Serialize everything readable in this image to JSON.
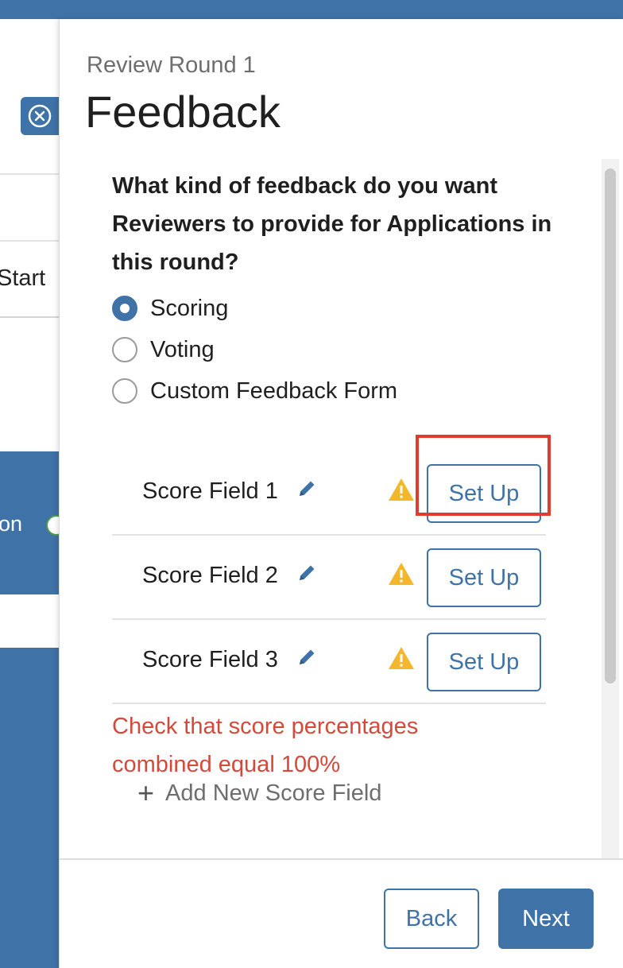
{
  "background": {
    "start_label": "Start",
    "card_text": "on"
  },
  "drawer": {
    "subtitle": "Review Round 1",
    "title": "Feedback",
    "question": "What kind of feedback do you want Reviewers to provide for Applications in this round?",
    "options": [
      {
        "label": "Scoring",
        "selected": true
      },
      {
        "label": "Voting",
        "selected": false
      },
      {
        "label": "Custom Feedback Form",
        "selected": false
      }
    ],
    "score_fields": [
      {
        "label": "Score Field 1",
        "button": "Set Up"
      },
      {
        "label": "Score Field 2",
        "button": "Set Up"
      },
      {
        "label": "Score Field 3",
        "button": "Set Up"
      }
    ],
    "error_text": "Check that score percentages combined equal 100%",
    "add_field_label": "Add New Score Field",
    "footer": {
      "back_label": "Back",
      "next_label": "Next"
    }
  },
  "colors": {
    "primary": "#3f72a6",
    "error": "#d44a3a",
    "warning": "#f2b72c",
    "highlight": "#e03c2e"
  },
  "icons": [
    "close-circle-icon",
    "pencil-icon",
    "warning-icon",
    "plus-icon",
    "check-circle-icon"
  ]
}
